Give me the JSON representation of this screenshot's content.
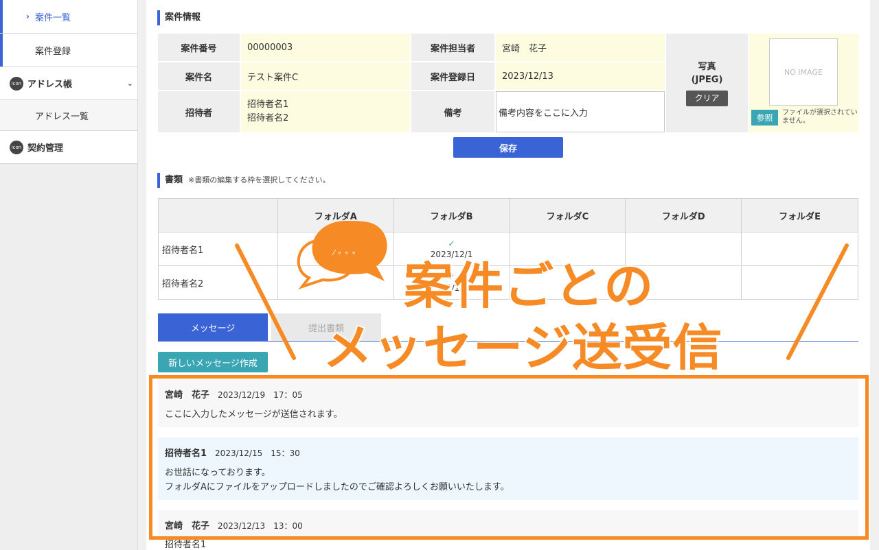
{
  "sidebar": {
    "items": [
      {
        "label": "案件一覧"
      },
      {
        "label": "案件登録"
      },
      {
        "label": "アドレス帳",
        "icon_text": "icon"
      },
      {
        "label": "アドレス一覧"
      },
      {
        "label": "契約管理",
        "icon_text": "icon"
      }
    ]
  },
  "case_info": {
    "title": "案件情報",
    "labels": {
      "number": "案件番号",
      "assignee": "案件担当者",
      "name": "案件名",
      "registered": "案件登録日",
      "invitee": "招待者",
      "remarks": "備考",
      "photo": "写真",
      "photo_format": "(JPEG)"
    },
    "values": {
      "number": "00000003",
      "assignee": "宮崎　花子",
      "name": "テスト案件C",
      "registered": "2023/12/13",
      "invitee_1": "招待者名1",
      "invitee_2": "招待者名2",
      "remarks": "備考内容をここに入力"
    },
    "clear_label": "クリア",
    "no_image": "NO IMAGE",
    "ref_label": "参照",
    "no_file": "ファイルが選択されていません。",
    "save_label": "保存"
  },
  "documents": {
    "title": "書類",
    "note": "※書類の編集する枠を選択してください。",
    "columns": [
      "フォルダA",
      "フォルダB",
      "フォルダC",
      "フォルダD",
      "フォルダE"
    ],
    "rows": [
      {
        "name": "招待者名1",
        "folder_b_date": "2023/12/1"
      },
      {
        "name": "招待者名2",
        "folder_b_date": "/12/15"
      }
    ]
  },
  "tabs": {
    "messages": "メッセージ",
    "submitted": "提出書類"
  },
  "new_message_label": "新しいメッセージ作成",
  "messages": [
    {
      "sender": "宮崎　花子",
      "time": "2023/12/19　17：05",
      "body": "ここに入力したメッセージが送信されます。"
    },
    {
      "sender": "招待者名1",
      "time": "2023/12/15　15：30",
      "body1": "お世話になっております。",
      "body2": "フォルダAにファイルをアップロードしましたのでご確認よろしくお願いいたします。"
    },
    {
      "sender": "宮崎　花子",
      "time": "2023/12/13　13：00"
    },
    {
      "sender": "招待者名1"
    }
  ],
  "overlay": {
    "line1": "案件ごとの",
    "line2": "メッセージ送受信",
    "bubble_text": "⁄ ∘ ∘ ∘"
  },
  "colors": {
    "accent": "#3a63d6",
    "teal": "#3aa6b4",
    "highlight": "#f68a24"
  }
}
